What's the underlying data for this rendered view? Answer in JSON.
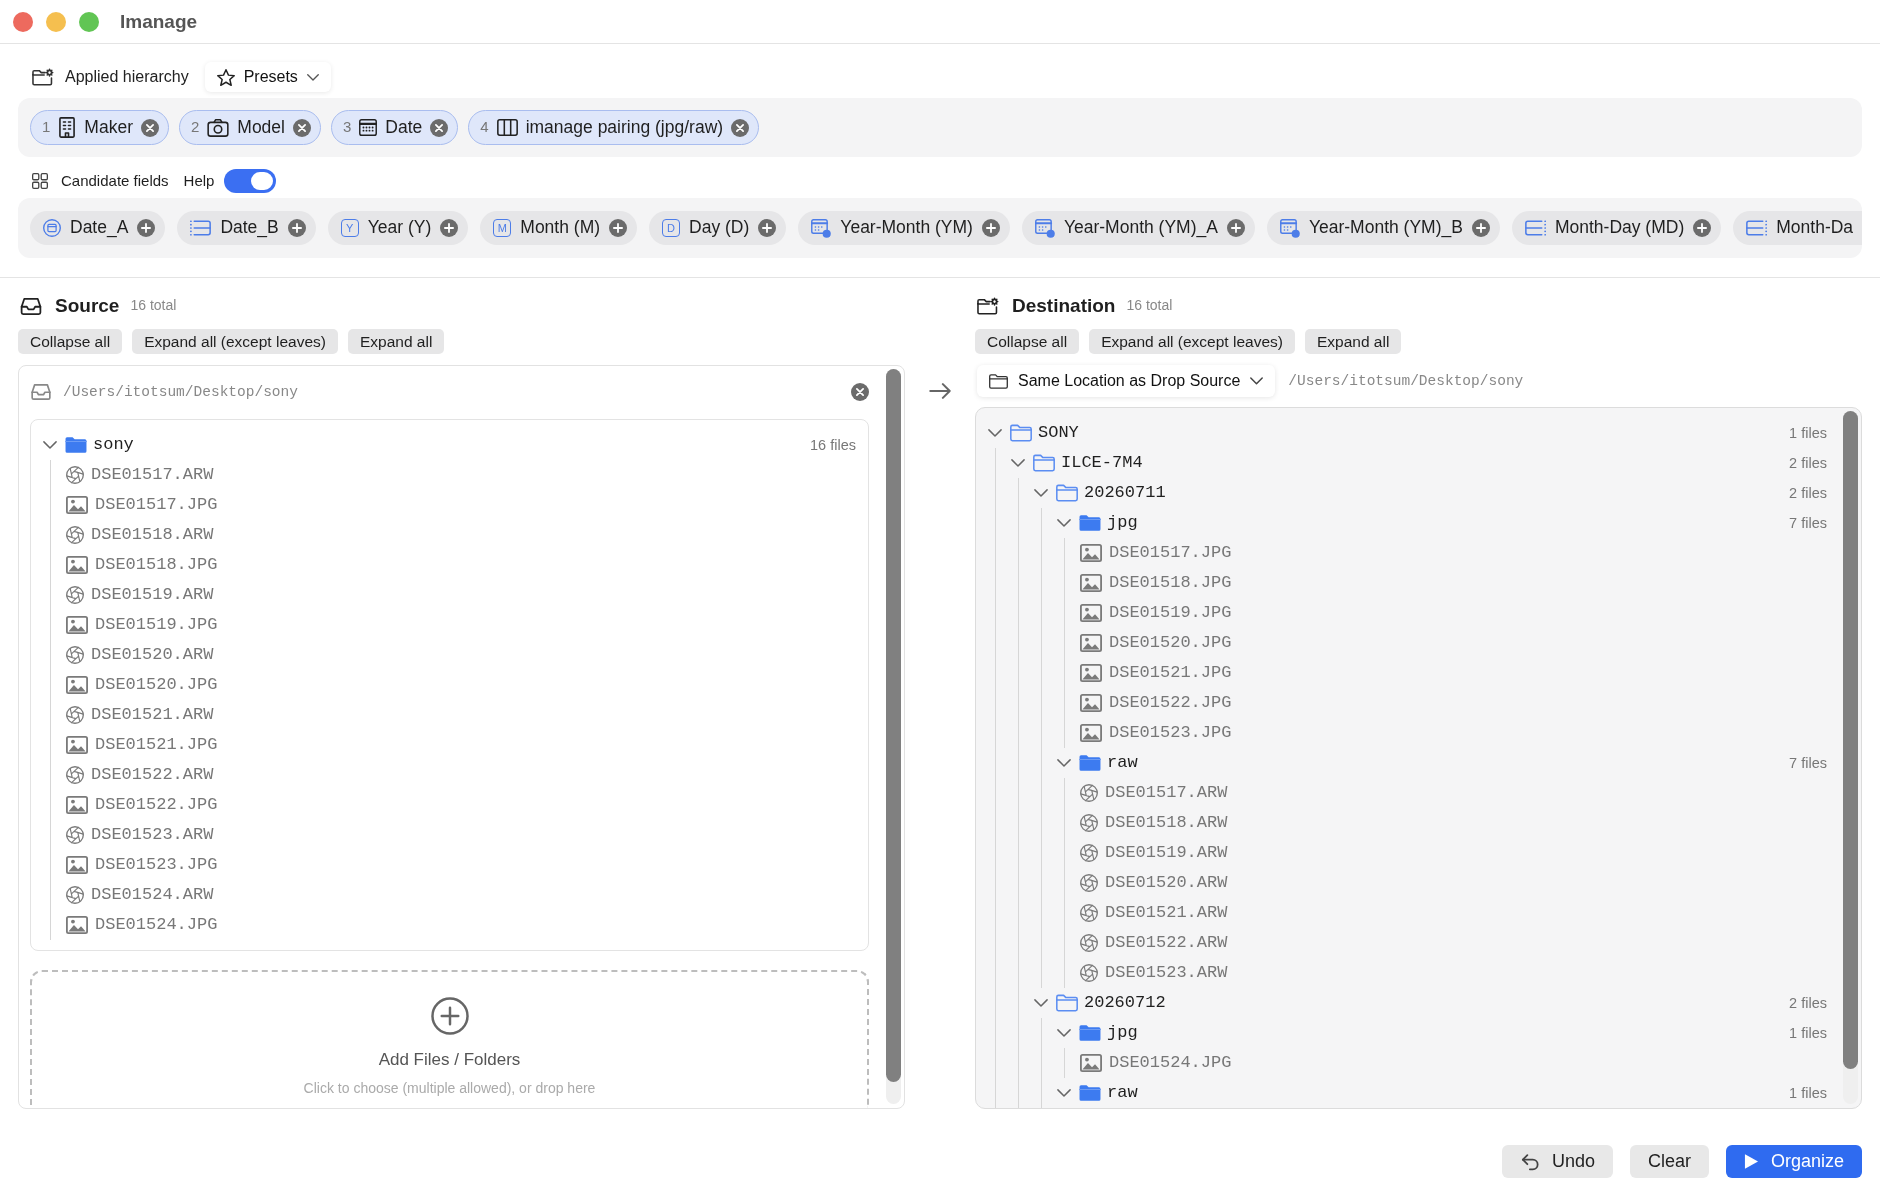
{
  "window": {
    "title": "Imanage"
  },
  "applied_hierarchy": {
    "label": "Applied hierarchy",
    "presets_button": "Presets",
    "chips": [
      {
        "number": "1",
        "kind": "maker",
        "label": "Maker"
      },
      {
        "number": "2",
        "kind": "model",
        "label": "Model"
      },
      {
        "number": "3",
        "kind": "date",
        "label": "Date"
      },
      {
        "number": "4",
        "kind": "pairing",
        "label": "imanage pairing (jpg/raw)"
      }
    ]
  },
  "candidate_fields": {
    "label": "Candidate fields",
    "help_toggle": {
      "label": "Help",
      "on": true
    },
    "chips": [
      {
        "kind": "circle",
        "label": "Date_A",
        "truncated": false
      },
      {
        "kind": "table",
        "label": "Date_B",
        "truncated": false
      },
      {
        "kind": "letter",
        "letter": "Y",
        "label": "Year (Y)",
        "truncated": false
      },
      {
        "kind": "letter",
        "letter": "M",
        "label": "Month (M)",
        "truncated": false
      },
      {
        "kind": "letter",
        "letter": "D",
        "label": "Day (D)",
        "truncated": false
      },
      {
        "kind": "calendar",
        "label": "Year-Month (YM)",
        "truncated": false
      },
      {
        "kind": "calendar",
        "label": "Year-Month (YM)_A",
        "truncated": false
      },
      {
        "kind": "calendar",
        "label": "Year-Month (YM)_B",
        "truncated": false
      },
      {
        "kind": "split",
        "label": "Month-Day (MD)",
        "truncated": false
      },
      {
        "kind": "split",
        "label": "Month-Da",
        "truncated": true
      }
    ]
  },
  "source": {
    "title": "Source",
    "count": "16 total",
    "buttons": [
      "Collapse all",
      "Expand all (except leaves)",
      "Expand all"
    ],
    "path": "/Users/itotsum/Desktop/sony",
    "tree": [
      {
        "kind": "folder",
        "name": "sony",
        "filled": true,
        "expanded": true,
        "count": "16 files",
        "children": [
          {
            "kind": "raw",
            "name": "DSE01517.ARW"
          },
          {
            "kind": "image",
            "name": "DSE01517.JPG"
          },
          {
            "kind": "raw",
            "name": "DSE01518.ARW"
          },
          {
            "kind": "image",
            "name": "DSE01518.JPG"
          },
          {
            "kind": "raw",
            "name": "DSE01519.ARW"
          },
          {
            "kind": "image",
            "name": "DSE01519.JPG"
          },
          {
            "kind": "raw",
            "name": "DSE01520.ARW"
          },
          {
            "kind": "image",
            "name": "DSE01520.JPG"
          },
          {
            "kind": "raw",
            "name": "DSE01521.ARW"
          },
          {
            "kind": "image",
            "name": "DSE01521.JPG"
          },
          {
            "kind": "raw",
            "name": "DSE01522.ARW"
          },
          {
            "kind": "image",
            "name": "DSE01522.JPG"
          },
          {
            "kind": "raw",
            "name": "DSE01523.ARW"
          },
          {
            "kind": "image",
            "name": "DSE01523.JPG"
          },
          {
            "kind": "raw",
            "name": "DSE01524.ARW"
          },
          {
            "kind": "image",
            "name": "DSE01524.JPG"
          }
        ]
      }
    ],
    "drop_zone": {
      "title": "Add Files / Folders",
      "hint": "Click to choose (multiple allowed), or drop here"
    }
  },
  "destination": {
    "title": "Destination",
    "count": "16 total",
    "buttons": [
      "Collapse all",
      "Expand all (except leaves)",
      "Expand all"
    ],
    "location": "Same Location as Drop Source",
    "path": "/Users/itotsum/Desktop/sony",
    "tree": [
      {
        "kind": "folder",
        "name": "SONY",
        "filled": false,
        "expanded": true,
        "count": "1 files",
        "children": [
          {
            "kind": "folder",
            "name": "ILCE-7M4",
            "filled": false,
            "expanded": true,
            "count": "2 files",
            "children": [
              {
                "kind": "folder",
                "name": "20260711",
                "filled": false,
                "expanded": true,
                "count": "2 files",
                "children": [
                  {
                    "kind": "folder",
                    "name": "jpg",
                    "filled": true,
                    "expanded": true,
                    "count": "7 files",
                    "children": [
                      {
                        "kind": "image",
                        "name": "DSE01517.JPG"
                      },
                      {
                        "kind": "image",
                        "name": "DSE01518.JPG"
                      },
                      {
                        "kind": "image",
                        "name": "DSE01519.JPG"
                      },
                      {
                        "kind": "image",
                        "name": "DSE01520.JPG"
                      },
                      {
                        "kind": "image",
                        "name": "DSE01521.JPG"
                      },
                      {
                        "kind": "image",
                        "name": "DSE01522.JPG"
                      },
                      {
                        "kind": "image",
                        "name": "DSE01523.JPG"
                      }
                    ]
                  },
                  {
                    "kind": "folder",
                    "name": "raw",
                    "filled": true,
                    "expanded": true,
                    "count": "7 files",
                    "children": [
                      {
                        "kind": "raw",
                        "name": "DSE01517.ARW"
                      },
                      {
                        "kind": "raw",
                        "name": "DSE01518.ARW"
                      },
                      {
                        "kind": "raw",
                        "name": "DSE01519.ARW"
                      },
                      {
                        "kind": "raw",
                        "name": "DSE01520.ARW"
                      },
                      {
                        "kind": "raw",
                        "name": "DSE01521.ARW"
                      },
                      {
                        "kind": "raw",
                        "name": "DSE01522.ARW"
                      },
                      {
                        "kind": "raw",
                        "name": "DSE01523.ARW"
                      }
                    ]
                  }
                ]
              },
              {
                "kind": "folder",
                "name": "20260712",
                "filled": false,
                "expanded": true,
                "count": "2 files",
                "children": [
                  {
                    "kind": "folder",
                    "name": "jpg",
                    "filled": true,
                    "expanded": true,
                    "count": "1 files",
                    "children": [
                      {
                        "kind": "image",
                        "name": "DSE01524.JPG"
                      }
                    ]
                  },
                  {
                    "kind": "folder",
                    "name": "raw",
                    "filled": true,
                    "expanded": true,
                    "count": "1 files"
                  }
                ]
              }
            ]
          }
        ]
      }
    ]
  },
  "actions": [
    {
      "kind": "undo",
      "label": "Undo"
    },
    {
      "kind": "clear",
      "label": "Clear"
    },
    {
      "kind": "organize",
      "label": "Organize"
    }
  ]
}
